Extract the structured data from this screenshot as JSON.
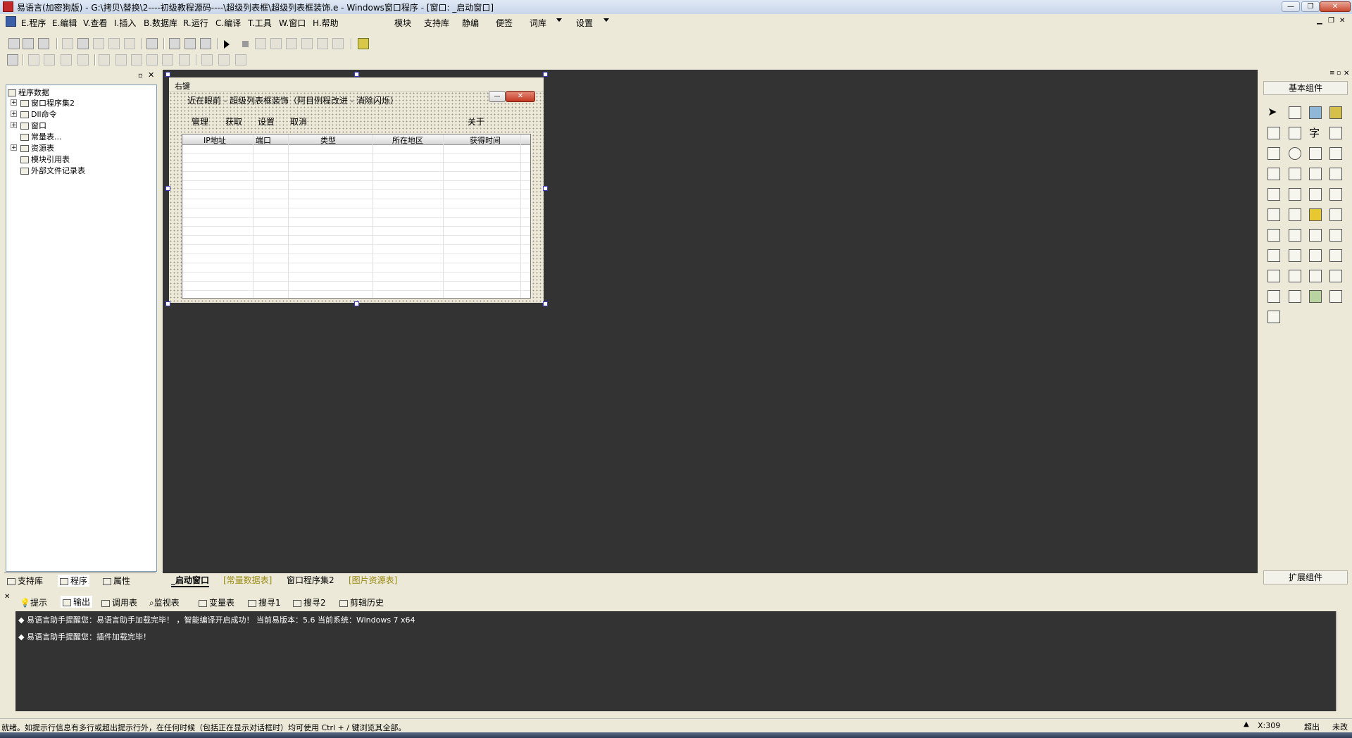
{
  "window": {
    "title": "易语言(加密狗版) - G:\\拷贝\\替换\\2----初级教程源码----\\超级列表框\\超级列表框装饰.e - Windows窗口程序 - [窗口: _启动窗口]",
    "minimize_label": "—",
    "restore_label": "❐",
    "close_label": "✕"
  },
  "menubar": {
    "items": [
      "E.程序",
      "E.编辑",
      "V.查看",
      "I.插入",
      "B.数据库",
      "R.运行",
      "C.编译",
      "T.工具",
      "W.窗口",
      "H.帮助"
    ],
    "extra": [
      "模块",
      "支持库",
      "静编",
      "便签",
      "词库",
      "设置"
    ]
  },
  "tree": {
    "root": "程序数据",
    "items": [
      "窗口程序集2",
      "Dll命令",
      "窗口",
      "常量表...",
      "资源表",
      "模块引用表",
      "外部文件记录表"
    ]
  },
  "left_tabs": [
    "支持库",
    "程序",
    "属性"
  ],
  "form": {
    "right_click_label": "右键",
    "caption": "近在眼前 - 超级列表框装饰（阿目例程改进 - 消除闪烁）",
    "buttons": [
      "管理",
      "获取",
      "设置",
      "取消",
      "关于"
    ],
    "columns": [
      "IP地址",
      "端口",
      "类型",
      "所在地区",
      "获得时间"
    ]
  },
  "right_panel": {
    "header": "基本组件",
    "footer": "扩展组件"
  },
  "editor_tabs": [
    "_启动窗口",
    "[常量数据表]",
    "窗口程序集2",
    "[图片资源表]"
  ],
  "output_tabs": [
    "提示",
    "输出",
    "调用表",
    "监视表",
    "变量表",
    "搜寻1",
    "搜寻2",
    "剪辑历史"
  ],
  "output_lines": [
    "易语言助手提醒您：易语言助手加载完毕！ ，智能编译开启成功！ 当前易版本：5.6  当前系统：Windows 7 x64",
    "易语言助手提醒您：插件加载完毕！"
  ],
  "status": {
    "text": "就绪。如提示行信息有多行或超出提示行外，在任何时候（包括正在显示对话框时）均可使用 Ctrl + / 键浏览其全部。",
    "coord": "X:309",
    "mode1": "超出",
    "mode2": "未改"
  },
  "colors": {
    "editor_bg": "#333333",
    "panel_bg": "#ece9d8",
    "accent": "#c0282a"
  }
}
